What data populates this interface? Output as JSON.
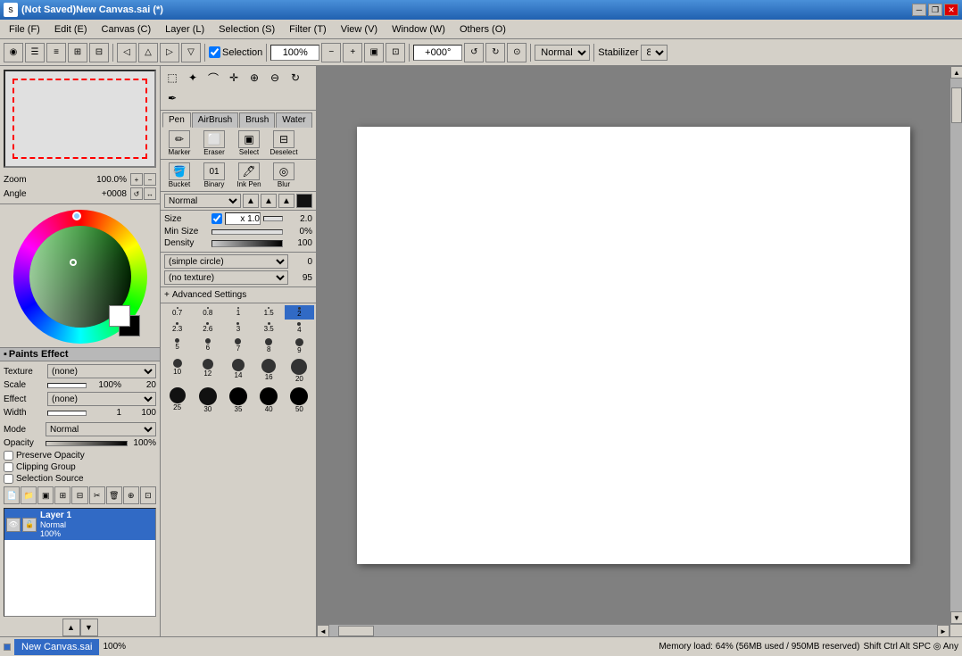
{
  "app": {
    "title": "(Not Saved)New Canvas.sai (*)",
    "icon": "SAI"
  },
  "title_buttons": {
    "minimize": "─",
    "maximize": "□",
    "restore": "❐",
    "close": "✕"
  },
  "menu": {
    "items": [
      {
        "id": "file",
        "label": "File (F)"
      },
      {
        "id": "edit",
        "label": "Edit (E)"
      },
      {
        "id": "canvas",
        "label": "Canvas (C)"
      },
      {
        "id": "layer",
        "label": "Layer (L)"
      },
      {
        "id": "selection",
        "label": "Selection (S)"
      },
      {
        "id": "filter",
        "label": "Filter (T)"
      },
      {
        "id": "view",
        "label": "View (V)"
      },
      {
        "id": "window",
        "label": "Window (W)"
      },
      {
        "id": "others",
        "label": "Others (O)"
      }
    ]
  },
  "toolbar": {
    "selection_checkbox_label": "Selection",
    "zoom_value": "100%",
    "rotation_value": "+000°",
    "blend_mode": "Normal",
    "stabilizer_label": "Stabilizer",
    "stabilizer_value": "8"
  },
  "left_panel": {
    "zoom_label": "Zoom",
    "zoom_value": "100.0%",
    "angle_label": "Angle",
    "angle_value": "+0008",
    "paints_effect_header": "Paints Effect",
    "texture_label": "Texture",
    "texture_value": "(none)",
    "scale_label": "Scale",
    "scale_value": "100%",
    "scale_num": "20",
    "effect_label": "Effect",
    "effect_value": "(none)",
    "width_label": "Width",
    "width_value": "1",
    "width_max": "100",
    "mode_label": "Mode",
    "mode_value": "Normal",
    "opacity_label": "Opacity",
    "opacity_value": "100%",
    "preserve_opacity": "Preserve Opacity",
    "clipping_group": "Clipping Group",
    "selection_source": "Selection Source",
    "layer_name": "Layer 1",
    "layer_mode": "Normal",
    "layer_opacity": "100%"
  },
  "tool_panel": {
    "brush_tabs": [
      {
        "id": "pen",
        "label": "Pen",
        "active": true
      },
      {
        "id": "airbrush",
        "label": "AirBrush"
      },
      {
        "id": "brush",
        "label": "Brush"
      },
      {
        "id": "water",
        "label": "Water"
      }
    ],
    "brush_tools": [
      {
        "id": "marker",
        "label": "Marker"
      },
      {
        "id": "eraser",
        "label": "Eraser"
      },
      {
        "id": "select",
        "label": "Select"
      },
      {
        "id": "deselect",
        "label": "Deselect"
      }
    ],
    "bottom_tools": [
      {
        "id": "bucket",
        "label": "Bucket"
      },
      {
        "id": "binary",
        "label": "Binary"
      },
      {
        "id": "ink_pen",
        "label": "Ink Pen"
      },
      {
        "id": "blur",
        "label": "Blur"
      }
    ],
    "blend_mode": "Normal",
    "size_label": "Size",
    "size_check": true,
    "size_value": "x 1.0",
    "size_max": "2.0",
    "min_size_label": "Min Size",
    "min_size_value": "0%",
    "density_label": "Density",
    "density_value": "100",
    "brush_shape": "(simple circle)",
    "brush_shape_val": "0",
    "brush_texture": "(no texture)",
    "brush_texture_val": "95",
    "adv_settings_label": "Advanced Settings",
    "brush_sizes": [
      {
        "size": 0.7,
        "label": "0.7"
      },
      {
        "size": 0.8,
        "label": "0.8"
      },
      {
        "size": 1,
        "label": "1"
      },
      {
        "size": 1.5,
        "label": "1.5"
      },
      {
        "size": 2,
        "label": "2",
        "selected": true
      },
      {
        "size": 2.3,
        "label": "2.3"
      },
      {
        "size": 2.6,
        "label": "2.6"
      },
      {
        "size": 3,
        "label": "3"
      },
      {
        "size": 3.5,
        "label": "3.5"
      },
      {
        "size": 4,
        "label": "4"
      },
      {
        "size": 5,
        "label": "5"
      },
      {
        "size": 6,
        "label": "6"
      },
      {
        "size": 7,
        "label": "7"
      },
      {
        "size": 8,
        "label": "8"
      },
      {
        "size": 9,
        "label": "9"
      },
      {
        "size": 10,
        "label": "10"
      },
      {
        "size": 12,
        "label": "12"
      },
      {
        "size": 14,
        "label": "14"
      },
      {
        "size": 16,
        "label": "16"
      },
      {
        "size": 20,
        "label": "20"
      },
      {
        "size": 25,
        "label": "25"
      },
      {
        "size": 30,
        "label": "30"
      },
      {
        "size": 35,
        "label": "35"
      },
      {
        "size": 40,
        "label": "40"
      },
      {
        "size": 50,
        "label": "50"
      }
    ]
  },
  "status": {
    "tab_label": "New Canvas.sai",
    "zoom": "100%",
    "memory": "Memory load: 64% (56MB used / 950MB reserved)",
    "keys": "Shift Ctrl Alt SPC ◎ Any"
  }
}
